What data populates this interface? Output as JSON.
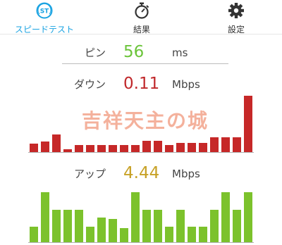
{
  "tabs": [
    {
      "label": "スピードテスト",
      "icon": "speedtest-logo-icon",
      "active": true
    },
    {
      "label": "結果",
      "icon": "stopwatch-icon",
      "active": false
    },
    {
      "label": "設定",
      "icon": "gear-icon",
      "active": false
    }
  ],
  "ping": {
    "label": "ピン",
    "value": "56",
    "unit": "ms",
    "color": "#6bc43a"
  },
  "download": {
    "label": "ダウン",
    "value": "0.11",
    "unit": "Mbps",
    "color": "#c0282b"
  },
  "upload": {
    "label": "アップ",
    "value": "4.44",
    "unit": "Mbps",
    "color": "#c7a126"
  },
  "watermark": "吉祥天主の城",
  "colors": {
    "accent": "#1aa3e2",
    "download_bar": "#c62828",
    "upload_bar": "#7cc22c"
  },
  "download_bars": [
    0.14,
    0.18,
    0.29,
    0.05,
    0.12,
    0.12,
    0.12,
    0.12,
    0.12,
    0.12,
    0.19,
    0.19,
    0.12,
    0.15,
    0.15,
    0.15,
    0.24,
    0.24,
    0.24,
    0.93
  ],
  "upload_bars": [
    0.27,
    0.87,
    0.56,
    0.56,
    0.56,
    0.27,
    0.43,
    0.4,
    0.24,
    0.87,
    0.56,
    0.56,
    0.27,
    0.56,
    0.27,
    0.27,
    0.56,
    0.87,
    0.56,
    0.87
  ]
}
